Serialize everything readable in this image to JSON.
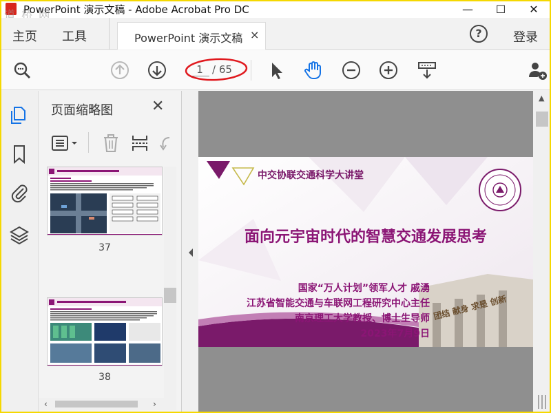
{
  "window": {
    "title": "PowerPoint 演示文稿 - Adobe Acrobat Pro DC",
    "watermark": "道 桥 网",
    "controls": [
      "—",
      "☐",
      "✕"
    ]
  },
  "menu": {
    "home_label": "主页",
    "tools_label": "工具",
    "tab_label": "PowerPoint 演示文稿",
    "tab_close": "×",
    "help_label": "?",
    "login_label": "登录"
  },
  "toolbar": {
    "page_current": "1",
    "page_total": "/ 65",
    "icons": [
      "search-icon",
      "page-up-icon",
      "page-down-icon",
      "select-cursor-icon",
      "hand-tool-icon",
      "zoom-out-icon",
      "zoom-in-icon",
      "fit-page-icon",
      "share-user-icon"
    ],
    "accent_color": "#1473e6",
    "highlight_color": "#e0191e"
  },
  "rail": {
    "icons": [
      "page-thumbnails-icon",
      "bookmark-icon",
      "attachment-icon",
      "layers-icon"
    ]
  },
  "thumbnails_panel": {
    "title": "页面缩略图",
    "close_label": "✕",
    "pages": [
      {
        "number": "37"
      },
      {
        "number": "38"
      }
    ]
  },
  "slide": {
    "header": "中交协联交通科学大讲堂",
    "title": "面向元宇宙时代的智慧交通发展思考",
    "lines": [
      "国家“万人计划”领军人才 戚湧",
      "江苏省智能交通与车联网工程研究中心主任",
      "南京理工大学教授、博士生导师",
      "2023年7月9日"
    ],
    "calligraphy": "团结 献身 求是 创新",
    "brand_color": "#8b1575"
  }
}
